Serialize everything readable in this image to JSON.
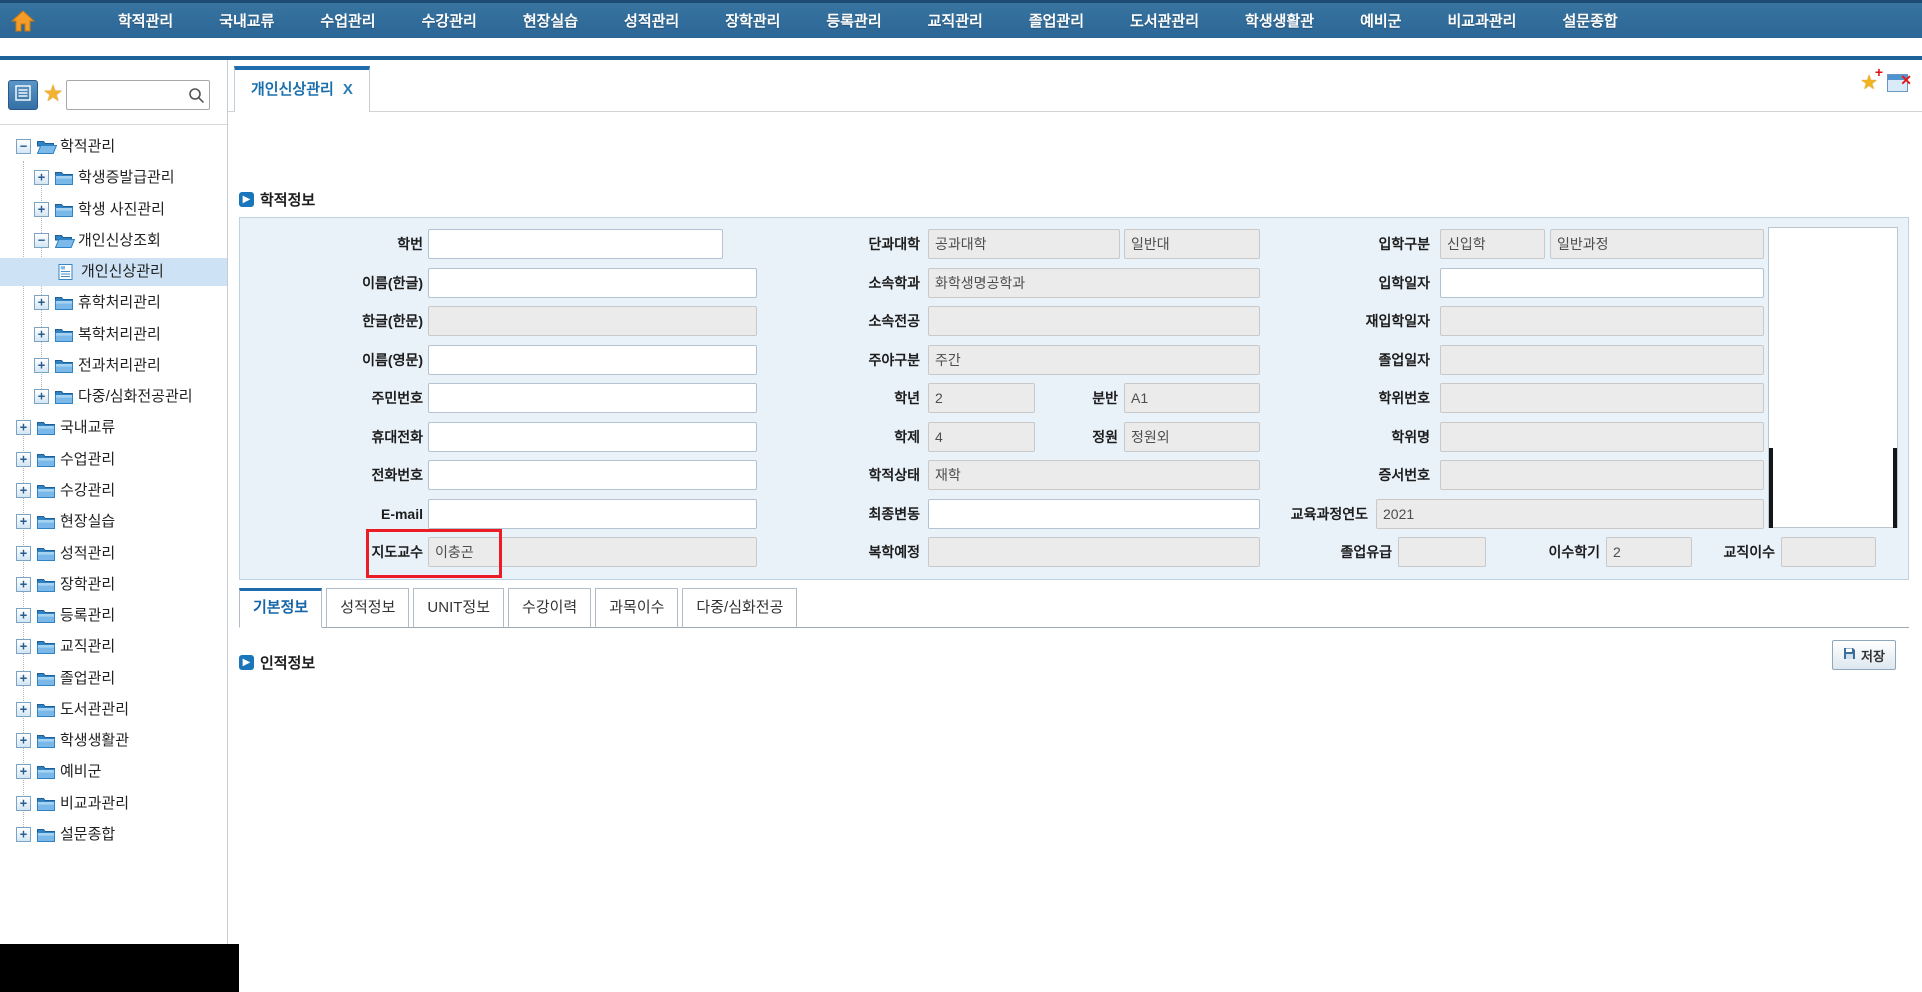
{
  "navbar": {
    "home_icon": "home-icon",
    "items": [
      "학적관리",
      "국내교류",
      "수업관리",
      "수강관리",
      "현장실습",
      "성적관리",
      "장학관리",
      "등록관리",
      "교직관리",
      "졸업관리",
      "도서관관리",
      "학생생활관",
      "예비군",
      "비교과관리",
      "설문종합"
    ]
  },
  "window_controls": {
    "add_favorite_icon": "star-plus-icon",
    "close_tab_icon": "window-close-icon"
  },
  "sidebar": {
    "menu_button_icon": "menu-list-icon",
    "favorites_button_icon": "star-icon",
    "search": {
      "value": "",
      "placeholder": "",
      "icon": "search-icon"
    },
    "tree": [
      {
        "label": "학적관리",
        "level": 0,
        "toggle": "minus",
        "icon": "folder-open",
        "selected": false
      },
      {
        "label": "학생증발급관리",
        "level": 1,
        "toggle": "plus",
        "icon": "folder",
        "selected": false
      },
      {
        "label": "학생 사진관리",
        "level": 1,
        "toggle": "plus",
        "icon": "folder",
        "selected": false
      },
      {
        "label": "개인신상조회",
        "level": 1,
        "toggle": "minus",
        "icon": "folder-open",
        "selected": false
      },
      {
        "label": "개인신상관리",
        "level": 2,
        "toggle": "none",
        "icon": "doc",
        "selected": true
      },
      {
        "label": "휴학처리관리",
        "level": 1,
        "toggle": "plus",
        "icon": "folder",
        "selected": false
      },
      {
        "label": "복학처리관리",
        "level": 1,
        "toggle": "plus",
        "icon": "folder",
        "selected": false
      },
      {
        "label": "전과처리관리",
        "level": 1,
        "toggle": "plus",
        "icon": "folder",
        "selected": false
      },
      {
        "label": "다중/심화전공관리",
        "level": 1,
        "toggle": "plus",
        "icon": "folder",
        "selected": false
      },
      {
        "label": "국내교류",
        "level": 0,
        "toggle": "plus",
        "icon": "folder",
        "selected": false
      },
      {
        "label": "수업관리",
        "level": 0,
        "toggle": "plus",
        "icon": "folder",
        "selected": false
      },
      {
        "label": "수강관리",
        "level": 0,
        "toggle": "plus",
        "icon": "folder",
        "selected": false
      },
      {
        "label": "현장실습",
        "level": 0,
        "toggle": "plus",
        "icon": "folder",
        "selected": false
      },
      {
        "label": "성적관리",
        "level": 0,
        "toggle": "plus",
        "icon": "folder",
        "selected": false
      },
      {
        "label": "장학관리",
        "level": 0,
        "toggle": "plus",
        "icon": "folder",
        "selected": false
      },
      {
        "label": "등록관리",
        "level": 0,
        "toggle": "plus",
        "icon": "folder",
        "selected": false
      },
      {
        "label": "교직관리",
        "level": 0,
        "toggle": "plus",
        "icon": "folder",
        "selected": false
      },
      {
        "label": "졸업관리",
        "level": 0,
        "toggle": "plus",
        "icon": "folder",
        "selected": false
      },
      {
        "label": "도서관관리",
        "level": 0,
        "toggle": "plus",
        "icon": "folder",
        "selected": false
      },
      {
        "label": "학생생활관",
        "level": 0,
        "toggle": "plus",
        "icon": "folder",
        "selected": false
      },
      {
        "label": "예비군",
        "level": 0,
        "toggle": "plus",
        "icon": "folder",
        "selected": false
      },
      {
        "label": "비교과관리",
        "level": 0,
        "toggle": "plus",
        "icon": "folder",
        "selected": false
      },
      {
        "label": "설문종합",
        "level": 0,
        "toggle": "plus",
        "icon": "folder",
        "selected": false
      }
    ]
  },
  "tab_bar": {
    "active_tab": {
      "label": "개인신상관리",
      "close": "X"
    }
  },
  "record_section": {
    "title": "학적정보"
  },
  "form": {
    "fields": [
      {
        "label": "학번",
        "value": "",
        "state": "editable"
      },
      {
        "label": "단과대학",
        "value": "공과대학",
        "state": "readonly"
      },
      {
        "label": "",
        "value": "일반대",
        "state": "readonly"
      },
      {
        "label": "입학구분",
        "value": "신입학",
        "state": "readonly"
      },
      {
        "label": "",
        "value": "일반과정",
        "state": "readonly"
      },
      {
        "label": "이름(한글)",
        "value": "",
        "state": "editable"
      },
      {
        "label": "소속학과",
        "value": "화학생명공학과",
        "state": "readonly"
      },
      {
        "label": "입학일자",
        "value": "",
        "state": "editable"
      },
      {
        "label": "한글(한문)",
        "value": "",
        "state": "readonly"
      },
      {
        "label": "소속전공",
        "value": "",
        "state": "readonly"
      },
      {
        "label": "재입학일자",
        "value": "",
        "state": "readonly"
      },
      {
        "label": "이름(영문)",
        "value": "",
        "state": "editable"
      },
      {
        "label": "주야구분",
        "value": "주간",
        "state": "readonly"
      },
      {
        "label": "졸업일자",
        "value": "",
        "state": "readonly"
      },
      {
        "label": "주민번호",
        "value": "",
        "state": "editable"
      },
      {
        "label": "학년",
        "value": "2",
        "state": "readonly"
      },
      {
        "label": "분반",
        "value": "A1",
        "state": "readonly"
      },
      {
        "label": "학위번호",
        "value": "",
        "state": "readonly"
      },
      {
        "label": "휴대전화",
        "value": "",
        "state": "editable"
      },
      {
        "label": "학제",
        "value": "4",
        "state": "readonly"
      },
      {
        "label": "정원",
        "value": "정원외",
        "state": "readonly"
      },
      {
        "label": "학위명",
        "value": "",
        "state": "readonly"
      },
      {
        "label": "전화번호",
        "value": "",
        "state": "editable"
      },
      {
        "label": "학적상태",
        "value": "재학",
        "state": "readonly"
      },
      {
        "label": "증서번호",
        "value": "",
        "state": "readonly"
      },
      {
        "label": "E-mail",
        "value": "",
        "state": "editable"
      },
      {
        "label": "최종변동",
        "value": "",
        "state": "editable"
      },
      {
        "label": "교육과정연도",
        "value": "2021",
        "state": "readonly"
      },
      {
        "label": "지도교수",
        "value": "이충곤",
        "state": "readonly",
        "highlighted": true
      },
      {
        "label": "복학예정",
        "value": "",
        "state": "readonly"
      },
      {
        "label": "졸업유급",
        "value": "",
        "state": "readonly"
      },
      {
        "label": "이수학기",
        "value": "2",
        "state": "readonly"
      },
      {
        "label": "교직이수",
        "value": "",
        "state": "readonly"
      }
    ]
  },
  "detail_tabs": {
    "items": [
      "기본정보",
      "성적정보",
      "UNIT정보",
      "수강이력",
      "과목이수",
      "다중/심화전공"
    ],
    "active_index": 0
  },
  "toolbar": {
    "save_label": "저장",
    "save_icon": "save-disk-icon"
  },
  "personal_section": {
    "title": "인적정보"
  }
}
